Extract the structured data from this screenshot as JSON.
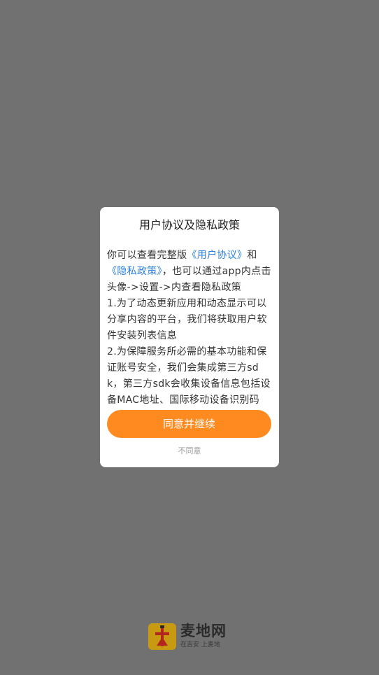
{
  "dialog": {
    "title": "用户协议及隐私政策",
    "body": {
      "intro_prefix": "你可以查看完整版",
      "user_agreement_link": "《用户协议》",
      "and": "和",
      "privacy_policy_link": "《隐私政策》",
      "intro_suffix": "，也可以通过app内点击头像->设置->内查看隐私政策",
      "item1": "1.为了动态更新应用和动态显示可以分享内容的平台，我们将获取用户软件安装列表信息",
      "item2": "2.为保障服务所必需的基本功能和保证账号安全，我们会集成第三方sdk，第三方sdk会收集设备信息包括设备MAC地址、国际移动设备识别码"
    },
    "agree_label": "同意并继续",
    "disagree_label": "不同意"
  },
  "brand": {
    "name": "麦地网",
    "slogan": "在吉安 上麦地"
  },
  "colors": {
    "overlay": "#717171",
    "accent": "#ff8a1f",
    "link": "#2b7fe0"
  }
}
